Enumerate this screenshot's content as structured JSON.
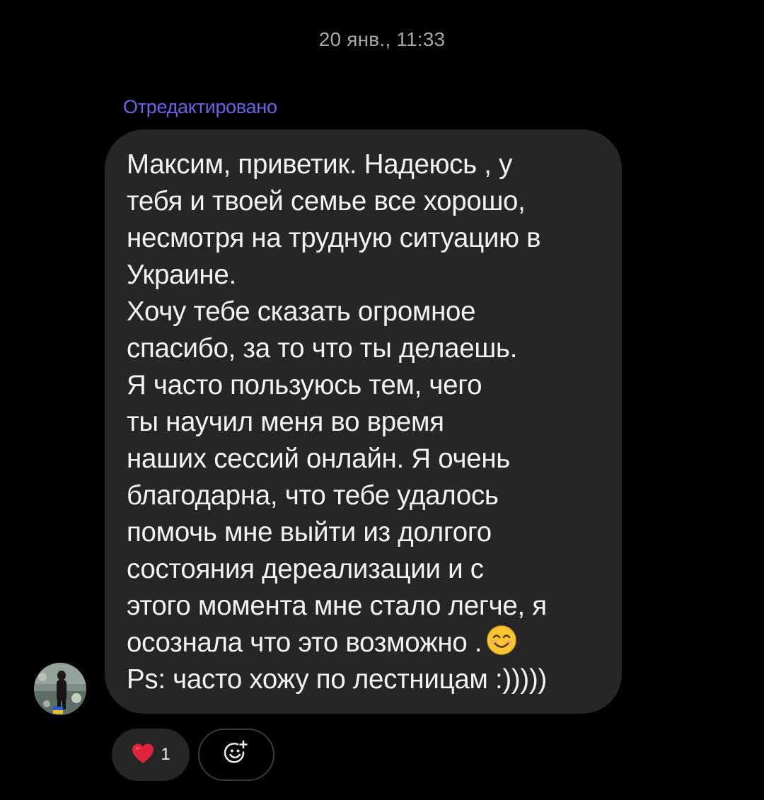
{
  "thread": {
    "timestamp": "20 янв., 11:33"
  },
  "message": {
    "edited_label": "Отредактировано",
    "lines": [
      "Максим, приветик. Надеюсь , у",
      "тебя и твоей семье все хорошо,",
      "несмотря на трудную ситуацию в",
      "Украине.",
      "Хочу тебе сказать огромное",
      "спасибо, за то что ты делаешь.",
      "Я часто пользуюсь тем, чего",
      "ты научил меня во время",
      "наших сессий онлайн. Я очень",
      "благодарна, что тебе удалось",
      "помочь мне выйти из долгого",
      "состояния дереализации и с",
      "этого момента мне стало легче, я",
      "осознала что это возможно .",
      "Ps: часто хожу по лестницам :)))))"
    ],
    "emoji_icon": "smiling-face-icon",
    "sender_avatar": "sender-avatar"
  },
  "reactions": {
    "heart": {
      "icon": "heart-icon",
      "count": "1"
    },
    "add_reaction_icon": "add-reaction-icon"
  },
  "colors": {
    "background": "#000000",
    "bubble": "#262626",
    "text": "#f2f2f2",
    "edited_accent": "#6a63e8",
    "timestamp": "#a8a8a8",
    "heart": "#e0243b"
  }
}
